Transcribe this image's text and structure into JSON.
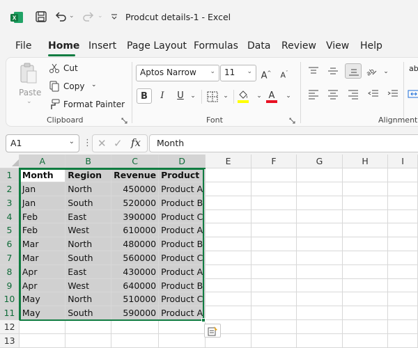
{
  "titlebar": {
    "doc_title": "Prodcut details-1  -  Excel",
    "app_icon_letter": "X"
  },
  "menu": {
    "tabs": [
      "File",
      "Home",
      "Insert",
      "Page Layout",
      "Formulas",
      "Data",
      "Review",
      "View",
      "Help"
    ],
    "active": "Home"
  },
  "ribbon": {
    "clipboard": {
      "paste": "Paste",
      "cut": "Cut",
      "copy": "Copy",
      "format_painter": "Format Painter",
      "group_label": "Clipboard"
    },
    "font": {
      "font_name": "Aptos Narrow",
      "font_size": "11",
      "bold": "B",
      "italic": "I",
      "underline": "U",
      "group_label": "Font",
      "fill_color": "#ffff00",
      "font_color": "#e81123"
    },
    "alignment": {
      "group_label": "Alignment",
      "wrap_partial": "ab"
    }
  },
  "formula_bar": {
    "name_box": "A1",
    "fx": "fx",
    "content": "Month"
  },
  "sheet": {
    "columns": [
      "A",
      "B",
      "C",
      "D",
      "E",
      "F",
      "G",
      "H",
      "I"
    ],
    "rows": [
      "1",
      "2",
      "3",
      "4",
      "5",
      "6",
      "7",
      "8",
      "9",
      "10",
      "11",
      "12",
      "13"
    ],
    "headers": [
      "Month",
      "Region",
      "Revenue",
      "Product"
    ],
    "data": [
      [
        "Jan",
        "North",
        "450000",
        "Product A"
      ],
      [
        "Jan",
        "South",
        "520000",
        "Product B"
      ],
      [
        "Feb",
        "East",
        "390000",
        "Product C"
      ],
      [
        "Feb",
        "West",
        "610000",
        "Product A"
      ],
      [
        "Mar",
        "North",
        "480000",
        "Product B"
      ],
      [
        "Mar",
        "South",
        "560000",
        "Product C"
      ],
      [
        "Apr",
        "East",
        "430000",
        "Product A"
      ],
      [
        "Apr",
        "West",
        "640000",
        "Product B"
      ],
      [
        "May",
        "North",
        "510000",
        "Product C"
      ],
      [
        "May",
        "South",
        "590000",
        "Product A"
      ]
    ],
    "accent": "#107c41"
  }
}
